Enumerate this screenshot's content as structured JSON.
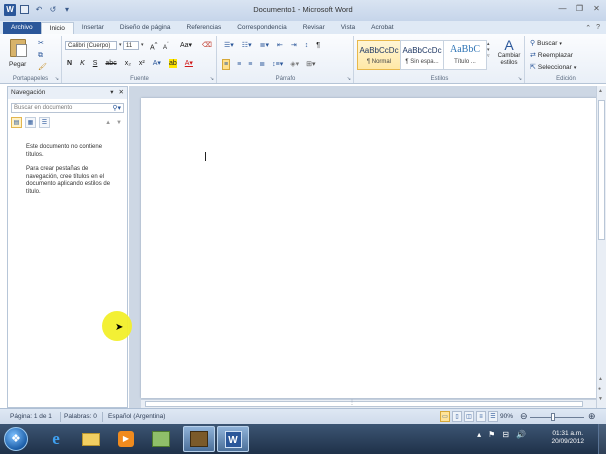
{
  "window": {
    "title": "Documento1 - Microsoft Word"
  },
  "qat": {
    "undo": "↶",
    "redo": "↺"
  },
  "tabs": [
    {
      "label": "Archivo",
      "kind": "file"
    },
    {
      "label": "Inicio",
      "kind": "active"
    },
    {
      "label": "Insertar",
      "kind": ""
    },
    {
      "label": "Diseño de página",
      "kind": ""
    },
    {
      "label": "Referencias",
      "kind": ""
    },
    {
      "label": "Correspondencia",
      "kind": ""
    },
    {
      "label": "Revisar",
      "kind": ""
    },
    {
      "label": "Vista",
      "kind": ""
    },
    {
      "label": "Acrobat",
      "kind": ""
    }
  ],
  "ribbon": {
    "portapapeles": {
      "label": "Portapapeles",
      "paste": "Pegar"
    },
    "fuente": {
      "label": "Fuente",
      "font_name": "Calibri (Cuerpo)",
      "font_size": "11"
    },
    "parrafo": {
      "label": "Párrafo"
    },
    "estilos": {
      "label": "Estilos",
      "items": [
        {
          "sample": "AaBbCcDc",
          "name": "¶ Normal"
        },
        {
          "sample": "AaBbCcDc",
          "name": "¶ Sin espa..."
        },
        {
          "sample": "AaBbC",
          "name": "Título ..."
        }
      ],
      "change": "Cambiar estilos"
    },
    "edicion": {
      "label": "Edición",
      "find": "Buscar",
      "replace": "Reemplazar",
      "select": "Seleccionar"
    }
  },
  "nav": {
    "title": "Navegación",
    "search_placeholder": "Buscar en documento",
    "message_1": "Este documento no contiene títulos.",
    "message_2": "Para crear pestañas de navegación, cree títulos en el documento aplicando estilos de título."
  },
  "status": {
    "page": "Página: 1 de 1",
    "words": "Palabras: 0",
    "language": "Español (Argentina)",
    "zoom": "90%"
  },
  "taskbar": {
    "time": "01:31 a.m.",
    "date": "20/09/2012"
  },
  "colors": {
    "word_blue": "#2b579a",
    "highlight_yellow": "#f2ef2a"
  }
}
